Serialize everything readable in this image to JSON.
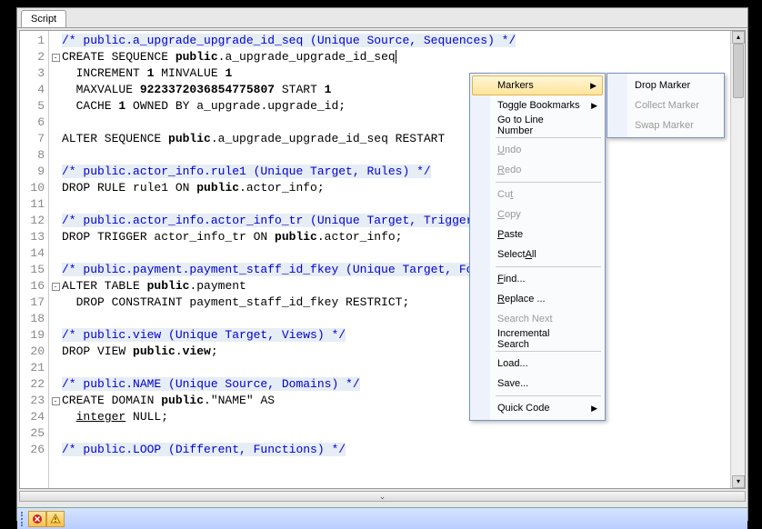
{
  "tab": {
    "label": "Script"
  },
  "lines": [
    {
      "n": 1,
      "fold": "",
      "cls": "comment",
      "text": "/* public.a_upgrade_upgrade_id_seq (Unique Source, Sequences) */"
    },
    {
      "n": 2,
      "fold": "-",
      "cls": "",
      "html": "CREATE SEQUENCE <span class='kw'>public</span>.a_upgrade_upgrade_id_seq<span class='caret'></span>"
    },
    {
      "n": 3,
      "fold": "",
      "cls": "",
      "html": "  INCREMENT <span class='kw'>1</span> MINVALUE <span class='kw'>1</span>"
    },
    {
      "n": 4,
      "fold": "",
      "cls": "",
      "html": "  MAXVALUE <span class='kw'>9223372036854775807</span> START <span class='kw'>1</span>"
    },
    {
      "n": 5,
      "fold": "",
      "cls": "",
      "html": "  CACHE <span class='kw'>1</span> OWNED BY a_upgrade.upgrade_id;"
    },
    {
      "n": 6,
      "fold": "",
      "cls": "",
      "text": ""
    },
    {
      "n": 7,
      "fold": "",
      "cls": "",
      "html": "ALTER SEQUENCE <span class='kw'>public</span>.a_upgrade_upgrade_id_seq RESTART "
    },
    {
      "n": 8,
      "fold": "",
      "cls": "",
      "text": ""
    },
    {
      "n": 9,
      "fold": "",
      "cls": "comment",
      "text": "/* public.actor_info.rule1 (Unique Target, Rules) */"
    },
    {
      "n": 10,
      "fold": "",
      "cls": "",
      "html": "DROP RULE rule1 ON <span class='kw'>public</span>.actor_info;"
    },
    {
      "n": 11,
      "fold": "",
      "cls": "",
      "text": ""
    },
    {
      "n": 12,
      "fold": "",
      "cls": "comment",
      "text": "/* public.actor_info.actor_info_tr (Unique Target, Triggers) */"
    },
    {
      "n": 13,
      "fold": "",
      "cls": "",
      "html": "DROP TRIGGER actor_info_tr ON <span class='kw'>public</span>.actor_info;"
    },
    {
      "n": 14,
      "fold": "",
      "cls": "",
      "text": ""
    },
    {
      "n": 15,
      "fold": "",
      "cls": "comment",
      "text": "/* public.payment.payment_staff_id_fkey (Unique Target, Foreign Keys) */"
    },
    {
      "n": 16,
      "fold": "-",
      "cls": "",
      "html": "ALTER TABLE <span class='kw'>public</span>.payment"
    },
    {
      "n": 17,
      "fold": "",
      "cls": "",
      "html": "  DROP CONSTRAINT payment_staff_id_fkey RESTRICT;"
    },
    {
      "n": 18,
      "fold": "",
      "cls": "",
      "text": ""
    },
    {
      "n": 19,
      "fold": "",
      "cls": "comment",
      "text": "/* public.view (Unique Target, Views) */"
    },
    {
      "n": 20,
      "fold": "",
      "cls": "",
      "html": "DROP VIEW <span class='kw'>public</span>.<span class='kw'>view</span>;"
    },
    {
      "n": 21,
      "fold": "",
      "cls": "",
      "text": ""
    },
    {
      "n": 22,
      "fold": "",
      "cls": "comment",
      "text": "/* public.NAME (Unique Source, Domains) */"
    },
    {
      "n": 23,
      "fold": "-",
      "cls": "",
      "html": "CREATE DOMAIN <span class='kw'>public</span>.&quot;NAME&quot; AS"
    },
    {
      "n": 24,
      "fold": "",
      "cls": "",
      "html": "  <span style='text-decoration:underline'>integer</span> NULL;"
    },
    {
      "n": 25,
      "fold": "",
      "cls": "",
      "text": ""
    },
    {
      "n": 26,
      "fold": "",
      "cls": "comment",
      "text": "/* public.LOOP (Different, Functions) */"
    }
  ],
  "context_menu": {
    "items": [
      {
        "label": "Markers",
        "arrow": true,
        "highlighted": true
      },
      {
        "label": "Toggle Bookmarks",
        "arrow": true
      },
      {
        "label": "Go to Line Number"
      },
      {
        "sep": true
      },
      {
        "label": "Undo",
        "u": 0,
        "disabled": true
      },
      {
        "label": "Redo",
        "u": 0,
        "disabled": true
      },
      {
        "sep": true
      },
      {
        "label": "Cut",
        "u": 2,
        "disabled": true
      },
      {
        "label": "Copy",
        "u": 0,
        "disabled": true
      },
      {
        "label": "Paste",
        "u": 0
      },
      {
        "label": "Select All",
        "u": 7
      },
      {
        "sep": true
      },
      {
        "label": "Find...",
        "u": 0
      },
      {
        "label": "Replace ...",
        "u": 0
      },
      {
        "label": "Search Next",
        "disabled": true
      },
      {
        "label": "Incremental Search"
      },
      {
        "sep": true
      },
      {
        "label": "Load..."
      },
      {
        "label": "Save..."
      },
      {
        "sep": true
      },
      {
        "label": "Quick Code",
        "arrow": true
      }
    ]
  },
  "submenu": {
    "items": [
      {
        "label": "Drop Marker"
      },
      {
        "label": "Collect Marker",
        "disabled": true
      },
      {
        "label": "Swap Marker",
        "disabled": true
      }
    ]
  }
}
